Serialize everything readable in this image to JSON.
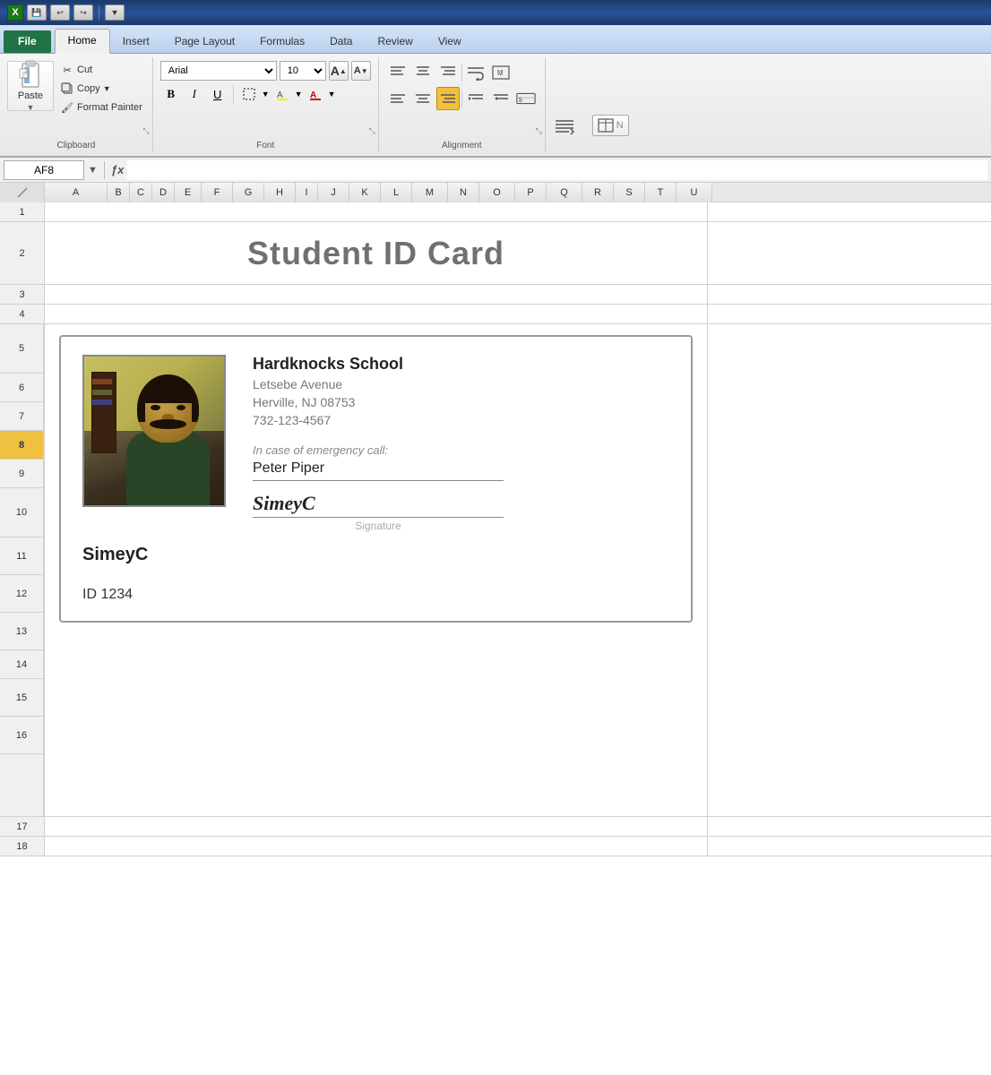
{
  "titlebar": {
    "icon": "X",
    "buttons": [
      "undo",
      "redo",
      "customize"
    ]
  },
  "tabs": {
    "file": "File",
    "home": "Home",
    "insert": "Insert",
    "pageLayout": "Page Layout",
    "formulas": "Formulas",
    "data": "Data",
    "review": "Review",
    "view": "View",
    "activeTab": "home"
  },
  "clipboard": {
    "label": "Clipboard",
    "pasteLabel": "Paste",
    "cutLabel": "Cut",
    "copyLabel": "Copy",
    "formatPainterLabel": "Format Painter"
  },
  "font": {
    "label": "Font",
    "fontName": "Arial",
    "fontSize": "10",
    "boldLabel": "B",
    "italicLabel": "I",
    "underlineLabel": "U"
  },
  "alignment": {
    "label": "Alignment"
  },
  "formulaBar": {
    "cellRef": "AF8",
    "formula": ""
  },
  "columns": [
    "A",
    "B",
    "C",
    "D",
    "E",
    "F",
    "G",
    "H",
    "I",
    "J",
    "K",
    "L",
    "M",
    "N",
    "O",
    "P",
    "Q",
    "R",
    "S",
    "T",
    "U"
  ],
  "rows": [
    1,
    2,
    3,
    4,
    5,
    6,
    7,
    8,
    9,
    10,
    11,
    12,
    13,
    14,
    15,
    16,
    17,
    18
  ],
  "selectedRow": 8,
  "card": {
    "title": "Student ID Card",
    "schoolName": "Hardknocks School",
    "address1": "Letsebe Avenue",
    "address2": "Herville, NJ 08753",
    "phone": "732-123-4567",
    "emergencyLabel": "In case of emergency call:",
    "emergencyContact": "Peter Piper",
    "signatureText": "SimeyC",
    "signatureLabel": "Signature",
    "studentName": "SimeyC",
    "studentId": "ID 1234"
  }
}
